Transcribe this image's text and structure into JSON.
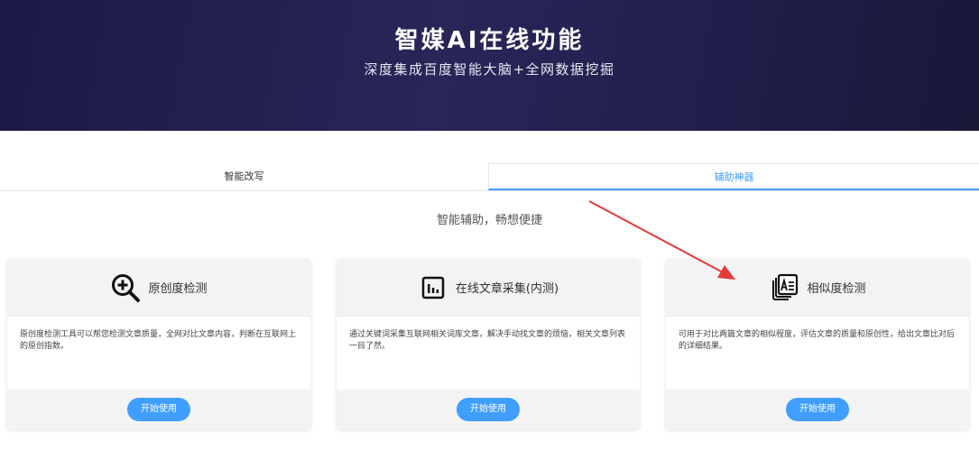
{
  "hero": {
    "title": "智媒AI在线功能",
    "subtitle": "深度集成百度智能大脑+全网数据挖掘"
  },
  "tabs": [
    {
      "label": "智能改写",
      "active": false
    },
    {
      "label": "辅助神器",
      "active": true
    }
  ],
  "section": {
    "subtitle": "智能辅助，畅想便捷"
  },
  "cards": [
    {
      "icon": "magnify-plus-icon",
      "title": "原创度检测",
      "description": "原创度检测工具可以帮您检测文章质量，全网对比文章内容，判断在互联网上的原创指数。",
      "button": "开始使用"
    },
    {
      "icon": "bar-chart-icon",
      "title": "在线文章采集(内测)",
      "description": "通过关键词采集互联网相关词库文章，解决手动找文章的烦恼，相关文章列表一目了然。",
      "button": "开始使用"
    },
    {
      "icon": "document-compare-icon",
      "title": "相似度检测",
      "description": "可用于对比两篇文章的相似程度，评估文章的质量和原创性，给出文章比对后的详细结果。",
      "button": "开始使用"
    }
  ],
  "colors": {
    "accent": "#409eff",
    "hero_bg": "#221f4d",
    "annotation_arrow": "#e53935"
  }
}
